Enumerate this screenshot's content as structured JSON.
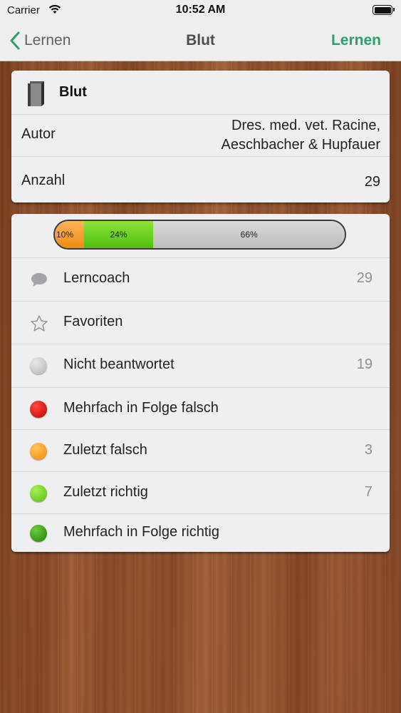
{
  "status_bar": {
    "carrier": "Carrier",
    "time": "10:52 AM"
  },
  "nav": {
    "back_label": "Lernen",
    "title": "Blut",
    "action_label": "Lernen"
  },
  "book": {
    "title": "Blut",
    "author_label": "Autor",
    "author_value_line1": "Dres. med. vet. Racine,",
    "author_value_line2": "Aeschbacher & Hupfauer",
    "count_label": "Anzahl",
    "count_value": "29"
  },
  "progress": {
    "segments": [
      {
        "label": "10%",
        "percent": 10,
        "color": "#f5a030"
      },
      {
        "label": "24%",
        "percent": 24,
        "color": "#5ccc17"
      },
      {
        "label": "66%",
        "percent": 66,
        "color": "#c6c6c6"
      }
    ]
  },
  "list": [
    {
      "label": "Lerncoach",
      "count": "29",
      "icon": "speech-bubble-icon"
    },
    {
      "label": "Favoriten",
      "count": "",
      "icon": "star-icon"
    },
    {
      "label": "Nicht beantwortet",
      "count": "19",
      "icon": "gray-dot-icon",
      "color": "#c4c4c4"
    },
    {
      "label": "Mehrfach in Folge falsch",
      "count": "",
      "icon": "red-dot-icon",
      "color": "#d10000"
    },
    {
      "label": "Zuletzt falsch",
      "count": "3",
      "icon": "orange-dot-icon",
      "color": "#ff9a0e"
    },
    {
      "label": "Zuletzt richtig",
      "count": "7",
      "icon": "light-green-dot-icon",
      "color": "#6fd41a"
    },
    {
      "label": "Mehrfach in Folge richtig",
      "count": "",
      "icon": "dark-green-dot-icon",
      "color": "#2f9a12"
    }
  ]
}
